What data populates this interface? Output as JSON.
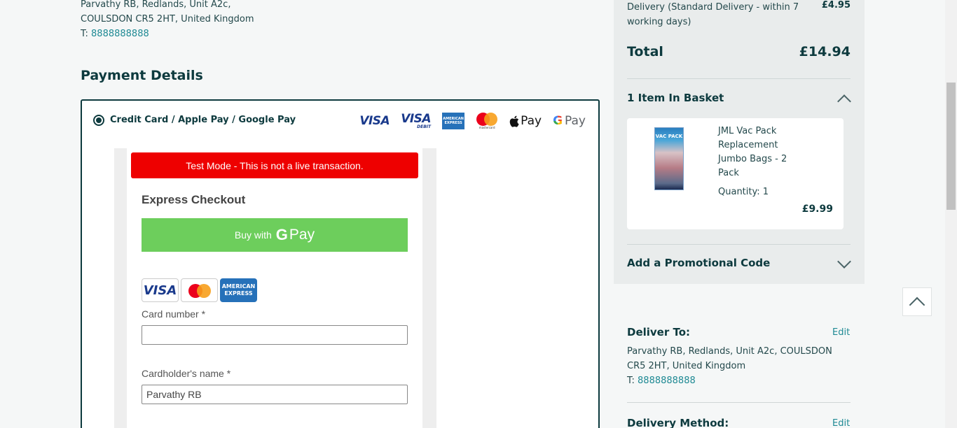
{
  "shipping_address": {
    "line1": "Parvathy RB, Redlands, Unit A2c,",
    "line2": "COULSDON CR5 2HT, United Kingdom",
    "tel_prefix": "T: ",
    "tel": "8888888888"
  },
  "payment": {
    "title": "Payment Details",
    "method_label": "Credit Card / Apple Pay / Google Pay",
    "logos": {
      "visa": "VISA",
      "visa_debit": "VISA",
      "visa_debit_sub": "DEBIT",
      "amex_line1": "AMERICAN",
      "amex_line2": "EXPRESS",
      "mastercard_text": "mastercard",
      "apple_pay": "Pay",
      "google_pay_g": "G",
      "google_pay": "Pay"
    },
    "test_banner": "Test Mode - This is not a live transaction.",
    "express_title": "Express Checkout",
    "gpay_button_prefix": "Buy with",
    "gpay_button_g": "G",
    "gpay_button_pay": "Pay",
    "card_icons": {
      "visa": "VISA",
      "amex_line1": "AMERICAN",
      "amex_line2": "EXPRESS"
    },
    "card_number_label": "Card number *",
    "card_number_value": "",
    "cardholder_label": "Cardholder's name *",
    "cardholder_value": "Parvathy RB"
  },
  "summary": {
    "delivery_label": "Delivery (Standard Delivery - within 7 working days)",
    "delivery_price": "£4.95",
    "total_label": "Total",
    "total_value": "£14.94",
    "basket_heading": "1 Item In Basket",
    "item": {
      "name": "JML Vac Pack Replacement Jumbo Bags - 2 Pack",
      "thumb_text": "VAC PACK",
      "quantity": "Quantity: 1",
      "price": "£9.99"
    },
    "promo_heading": "Add a Promotional Code"
  },
  "deliver_to": {
    "heading": "Deliver To:",
    "edit": "Edit",
    "address": "Parvathy RB, Redlands, Unit A2c, COULSDON CR5 2HT, United Kingdom",
    "tel_prefix": "T: ",
    "tel": "8888888888"
  },
  "delivery_method": {
    "heading": "Delivery Method:",
    "edit": "Edit"
  }
}
